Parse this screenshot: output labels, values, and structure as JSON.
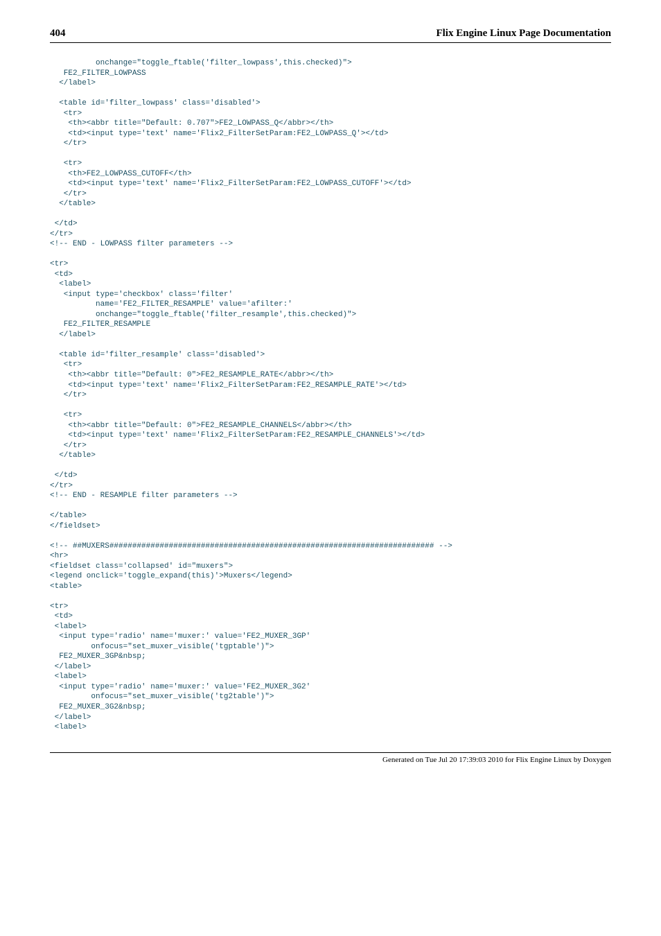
{
  "header": {
    "page_number": "404",
    "title": "Flix Engine Linux Page Documentation"
  },
  "code": "          onchange=\"toggle_ftable('filter_lowpass',this.checked)\">\n   FE2_FILTER_LOWPASS\n  </label>\n\n  <table id='filter_lowpass' class='disabled'>\n   <tr>\n    <th><abbr title=\"Default: 0.707\">FE2_LOWPASS_Q</abbr></th>\n    <td><input type='text' name='Flix2_FilterSetParam:FE2_LOWPASS_Q'></td>\n   </tr>\n\n   <tr>\n    <th>FE2_LOWPASS_CUTOFF</th>\n    <td><input type='text' name='Flix2_FilterSetParam:FE2_LOWPASS_CUTOFF'></td>\n   </tr>\n  </table>\n\n </td>\n</tr>\n<!-- END - LOWPASS filter parameters -->\n\n<tr>\n <td>\n  <label>\n   <input type='checkbox' class='filter'\n          name='FE2_FILTER_RESAMPLE' value='afilter:'\n          onchange=\"toggle_ftable('filter_resample',this.checked)\">\n   FE2_FILTER_RESAMPLE\n  </label>\n\n  <table id='filter_resample' class='disabled'>\n   <tr>\n    <th><abbr title=\"Default: 0\">FE2_RESAMPLE_RATE</abbr></th>\n    <td><input type='text' name='Flix2_FilterSetParam:FE2_RESAMPLE_RATE'></td>\n   </tr>\n\n   <tr>\n    <th><abbr title=\"Default: 0\">FE2_RESAMPLE_CHANNELS</abbr></th>\n    <td><input type='text' name='Flix2_FilterSetParam:FE2_RESAMPLE_CHANNELS'></td>\n   </tr>\n  </table>\n\n </td>\n</tr>\n<!-- END - RESAMPLE filter parameters -->\n\n</table>\n</fieldset>\n\n<!-- ##MUXERS####################################################################### -->\n<hr>\n<fieldset class='collapsed' id=\"muxers\">\n<legend onclick='toggle_expand(this)'>Muxers</legend>\n<table>\n\n<tr>\n <td>\n <label>\n  <input type='radio' name='muxer:' value='FE2_MUXER_3GP'\n         onfocus=\"set_muxer_visible('tgptable')\">\n  FE2_MUXER_3GP&nbsp;\n </label>\n <label>\n  <input type='radio' name='muxer:' value='FE2_MUXER_3G2'\n         onfocus=\"set_muxer_visible('tg2table')\">\n  FE2_MUXER_3G2&nbsp;\n </label>\n <label>",
  "footer": "Generated on Tue Jul 20 17:39:03 2010 for Flix Engine Linux by Doxygen"
}
